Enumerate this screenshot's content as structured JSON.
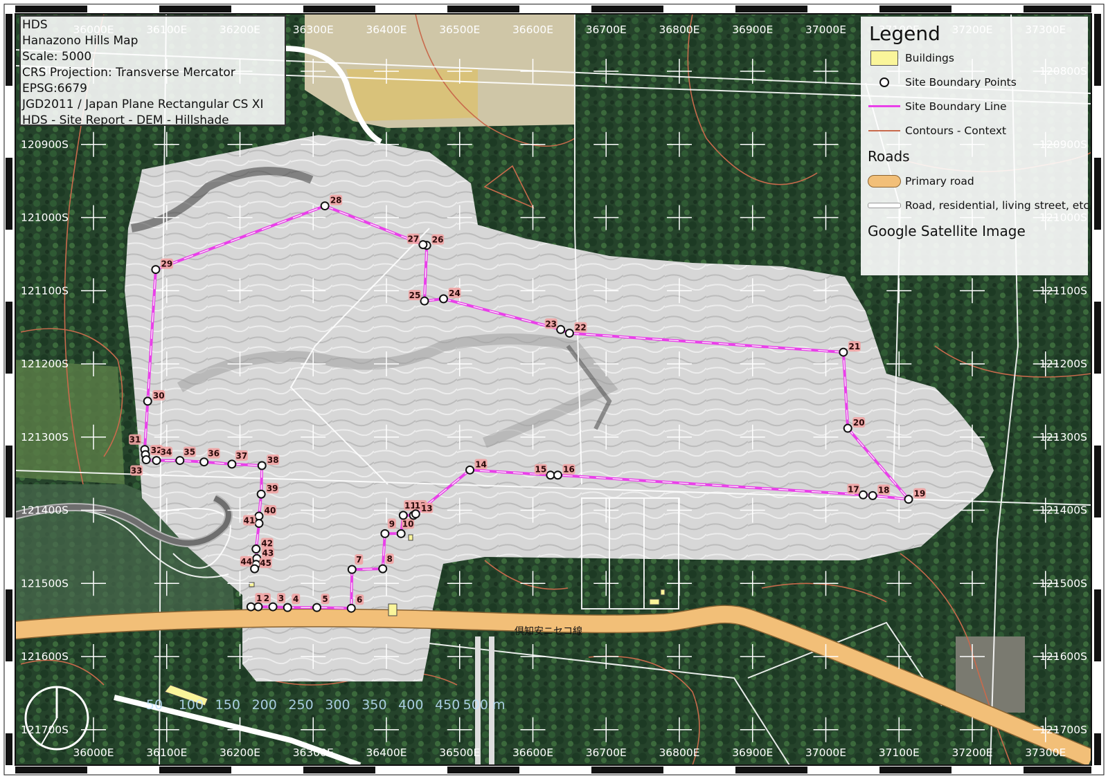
{
  "info": {
    "lines": [
      "HDS",
      "Hanazono Hills Map",
      "Scale: 5000",
      "CRS Projection: Transverse Mercator",
      "EPSG:6679",
      "JGD2011 / Japan Plane Rectangular CS XI",
      "HDS - Site Report - DEM - Hillshade"
    ]
  },
  "legend": {
    "title": "Legend",
    "items": [
      {
        "label": "Buildings",
        "icon": "building-swatch"
      },
      {
        "label": "Site Boundary Points",
        "icon": "point-symbol"
      },
      {
        "label": "Site Boundary Line",
        "icon": "magenta-line"
      },
      {
        "label": "Contours - Context",
        "icon": "contour-line"
      }
    ],
    "roads_title": "Roads",
    "road_items": [
      {
        "label": "Primary road",
        "icon": "primary-road-swatch"
      },
      {
        "label": "Road, residential, living street, etc.",
        "icon": "residential-road-swatch"
      }
    ],
    "basemap": "Google Satellite Image"
  },
  "grid": {
    "eastings": [
      "36000E",
      "36100E",
      "36200E",
      "36300E",
      "36400E",
      "36500E",
      "36600E",
      "36700E",
      "36800E",
      "36900E",
      "37000E",
      "37100E",
      "37200E",
      "37300E"
    ],
    "northings": [
      "120800S",
      "120900S",
      "121000S",
      "121100S",
      "121200S",
      "121300S",
      "121400S",
      "121500S",
      "121600S",
      "121700S"
    ]
  },
  "road_label": "倶知安ニセコ線",
  "scale_bar": {
    "labels": [
      "50",
      "100",
      "150",
      "200",
      "250",
      "300",
      "350",
      "400",
      "450",
      "500 m"
    ]
  },
  "boundary_points": [
    {
      "id": "1",
      "e": 36215,
      "n": 121532
    },
    {
      "id": "2",
      "e": 36225,
      "n": 121532
    },
    {
      "id": "3",
      "e": 36245,
      "n": 121532
    },
    {
      "id": "4",
      "e": 36265,
      "n": 121533
    },
    {
      "id": "5",
      "e": 36305,
      "n": 121533
    },
    {
      "id": "6",
      "e": 36352,
      "n": 121534
    },
    {
      "id": "7",
      "e": 36353,
      "n": 121481
    },
    {
      "id": "8",
      "e": 36395,
      "n": 121480
    },
    {
      "id": "9",
      "e": 36398,
      "n": 121432
    },
    {
      "id": "10",
      "e": 36420,
      "n": 121432
    },
    {
      "id": "11",
      "e": 36423,
      "n": 121407
    },
    {
      "id": "12",
      "e": 36437,
      "n": 121407
    },
    {
      "id": "13",
      "e": 36440,
      "n": 121405
    },
    {
      "id": "14",
      "e": 36514,
      "n": 121345
    },
    {
      "id": "15",
      "e": 36624,
      "n": 121352
    },
    {
      "id": "16",
      "e": 36634,
      "n": 121352
    },
    {
      "id": "17",
      "e": 37051,
      "n": 121379
    },
    {
      "id": "18",
      "e": 37064,
      "n": 121380
    },
    {
      "id": "19",
      "e": 37113,
      "n": 121385
    },
    {
      "id": "20",
      "e": 37030,
      "n": 121288
    },
    {
      "id": "21",
      "e": 37024,
      "n": 121184
    },
    {
      "id": "22",
      "e": 36650,
      "n": 121158
    },
    {
      "id": "23",
      "e": 36638,
      "n": 121153
    },
    {
      "id": "24",
      "e": 36478,
      "n": 121111
    },
    {
      "id": "25",
      "e": 36452,
      "n": 121114
    },
    {
      "id": "26",
      "e": 36455,
      "n": 121038
    },
    {
      "id": "27",
      "e": 36450,
      "n": 121037
    },
    {
      "id": "28",
      "e": 36316,
      "n": 120984
    },
    {
      "id": "29",
      "e": 36085,
      "n": 121071
    },
    {
      "id": "30",
      "e": 36074,
      "n": 121251
    },
    {
      "id": "31",
      "e": 36070,
      "n": 121317
    },
    {
      "id": "32",
      "e": 36071,
      "n": 121324
    },
    {
      "id": "33",
      "e": 36072,
      "n": 121331
    },
    {
      "id": "34",
      "e": 36086,
      "n": 121332
    },
    {
      "id": "35",
      "e": 36118,
      "n": 121332
    },
    {
      "id": "36",
      "e": 36151,
      "n": 121334
    },
    {
      "id": "37",
      "e": 36189,
      "n": 121337
    },
    {
      "id": "38",
      "e": 36230,
      "n": 121339
    },
    {
      "id": "39",
      "e": 36229,
      "n": 121378
    },
    {
      "id": "40",
      "e": 36226,
      "n": 121408
    },
    {
      "id": "41",
      "e": 36226,
      "n": 121418
    },
    {
      "id": "42",
      "e": 36222,
      "n": 121453
    },
    {
      "id": "43",
      "e": 36223,
      "n": 121466
    },
    {
      "id": "44",
      "e": 36222,
      "n": 121474
    },
    {
      "id": "45",
      "e": 36220,
      "n": 121480
    }
  ],
  "colors": {
    "boundary": "#e940e9",
    "primary_road": "#f2bf78",
    "primary_road_edge": "#8a6433",
    "contour": "#c86a4c",
    "label_bg": "#f1a3a3",
    "forest": "#24432a",
    "building": "#faf59a"
  }
}
